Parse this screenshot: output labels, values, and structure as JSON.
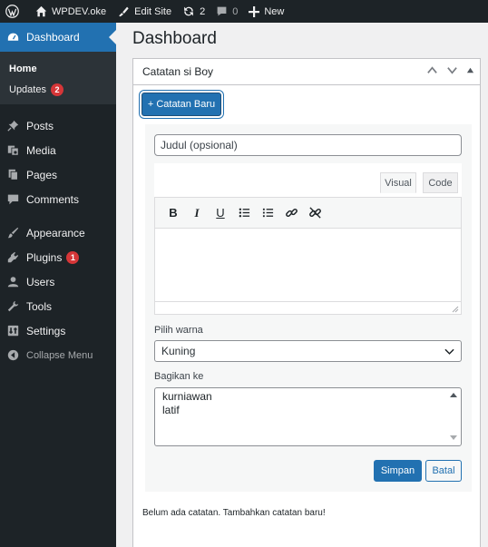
{
  "adminbar": {
    "wp_logo_icon": "wordpress-logo-icon",
    "site_name": "WPDEV.oke",
    "edit_site": "Edit Site",
    "updates_count": "2",
    "comments_count": "0",
    "new_label": "New"
  },
  "sidebar": {
    "dashboard": "Dashboard",
    "submenu": {
      "home": "Home",
      "updates": "Updates",
      "updates_badge": "2"
    },
    "items": [
      {
        "label": "Posts",
        "icon": "pushpin-icon"
      },
      {
        "label": "Media",
        "icon": "media-icon"
      },
      {
        "label": "Pages",
        "icon": "pages-icon"
      },
      {
        "label": "Comments",
        "icon": "comments-icon"
      },
      {
        "label": "Appearance",
        "icon": "paintbrush-icon"
      },
      {
        "label": "Plugins",
        "icon": "plugins-icon",
        "badge": "1"
      },
      {
        "label": "Users",
        "icon": "users-icon"
      },
      {
        "label": "Tools",
        "icon": "wrench-icon"
      },
      {
        "label": "Settings",
        "icon": "settings-icon"
      }
    ],
    "collapse": "Collapse Menu"
  },
  "main": {
    "title": "Dashboard",
    "widget": {
      "title": "Catatan si Boy",
      "new_button": "+ Catatan Baru",
      "form": {
        "title_placeholder": "Judul (opsional)",
        "tab_visual": "Visual",
        "tab_code": "Code",
        "toolbar": {
          "bold": "B",
          "italic": "I",
          "underline": "U"
        },
        "color_label": "Pilih warna",
        "color_value": "Kuning",
        "share_label": "Bagikan ke",
        "share_options": [
          "kurniawan",
          "latif"
        ],
        "save": "Simpan",
        "cancel": "Batal"
      },
      "empty_text": "Belum ada catatan. Tambahkan catatan baru!"
    }
  },
  "colors": {
    "adminbar_bg": "#1d2327",
    "accent": "#2271b1",
    "badge": "#d63638",
    "page_bg": "#f0f0f1"
  }
}
